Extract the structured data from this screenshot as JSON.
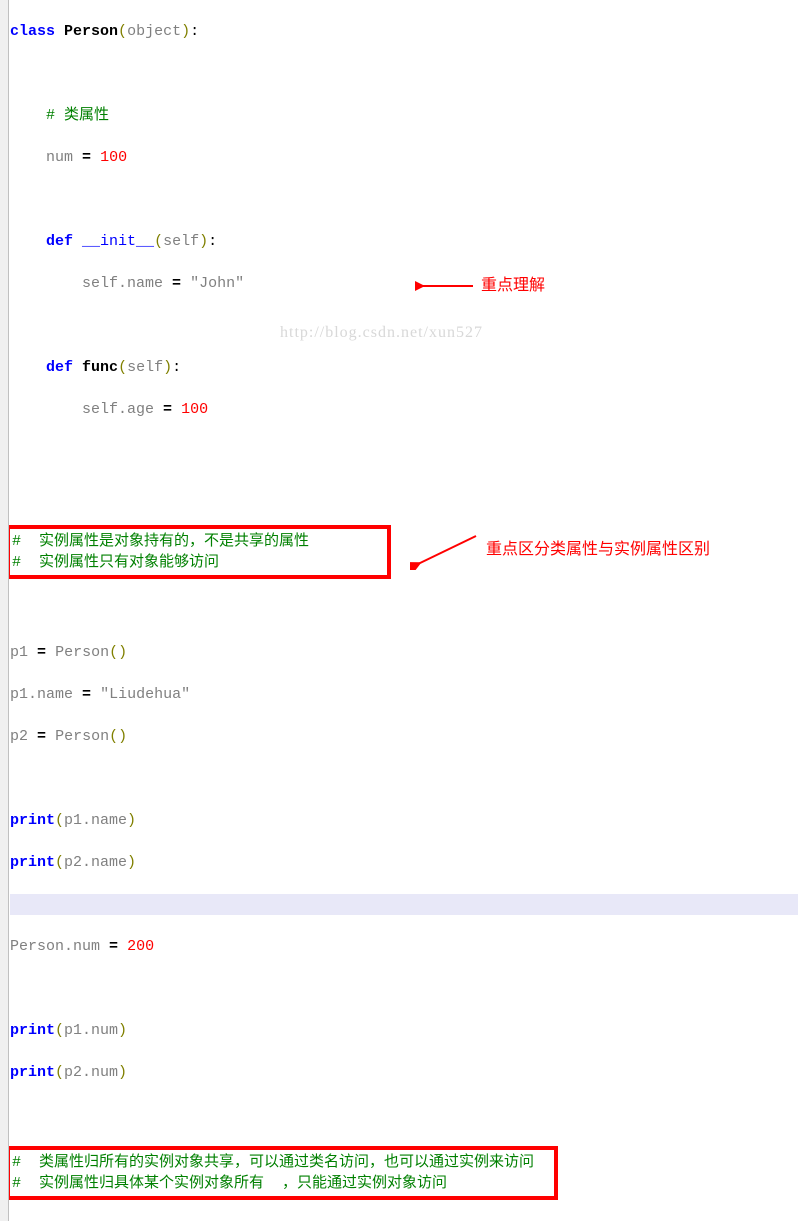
{
  "code": {
    "l1_class": "class",
    "l1_name": "Person",
    "l1_base": "object",
    "l3_cmt": "# 类属性",
    "l4_num": "num",
    "l4_val": "100",
    "l6_def": "def",
    "l6_init": "__init__",
    "l6_self": "self",
    "l7_assign": "self.name",
    "l7_val": "\"John\"",
    "l9_def": "def",
    "l9_fn": "func",
    "l9_self": "self",
    "l10_assign": "self.age",
    "l10_val": "100",
    "box1_a": "#  实例属性是对象持有的，不是共享的属性",
    "box1_b": "#  实例属性只有对象能够访问",
    "p1": "p1",
    "p2": "p2",
    "Person": "Person",
    "p1name": "p1.name",
    "liu": "\"Liudehua\"",
    "print": "print",
    "p1name2": "p1.name",
    "p2name": "p2.name",
    "pnum": "Person.num",
    "two_h": "200",
    "p1num": "p1.num",
    "p2num": "p2.num",
    "box2_a": "#  类属性归所有的实例对象共享，可以通过类名访问，也可以通过实例来访问",
    "box2_b": "#  实例属性归具体某个实例对象所有  ，只能通过实例对象访问"
  },
  "annotations": {
    "a1": "重点理解",
    "a2": "重点区分类属性与实例属性区别"
  },
  "watermark": "http://blog.csdn.net/xun527"
}
